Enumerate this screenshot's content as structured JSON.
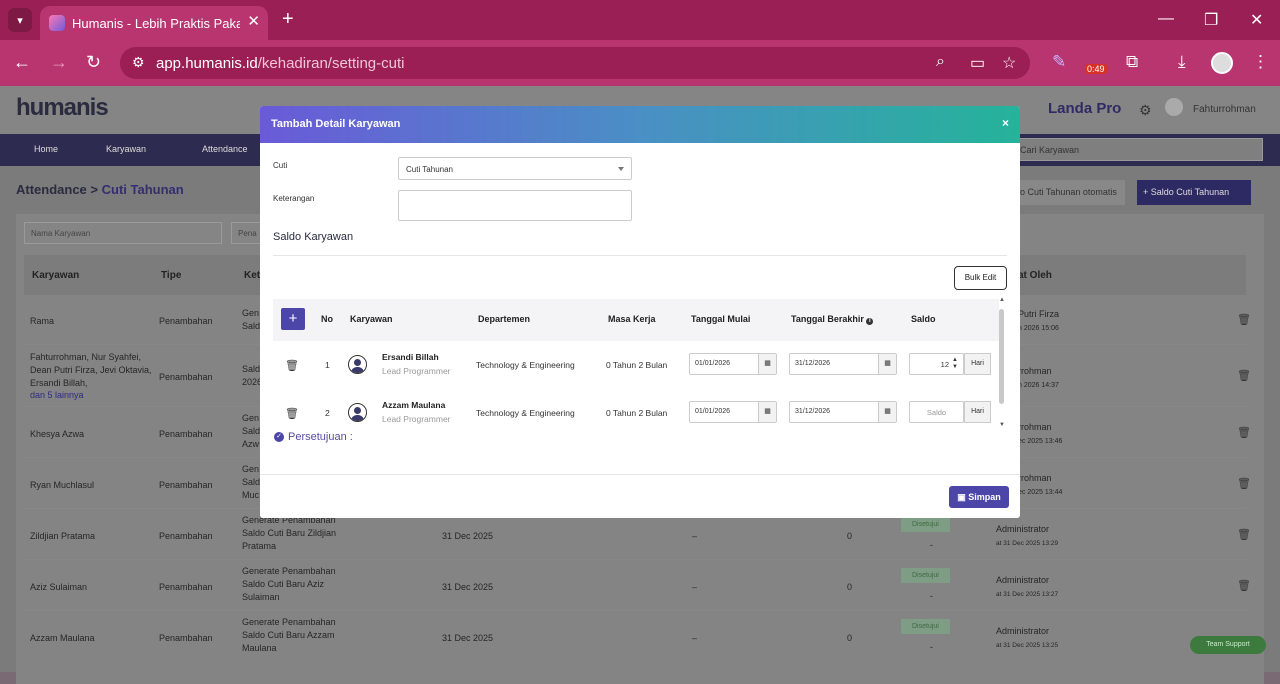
{
  "browser": {
    "tab_title": "Humanis - Lebih Praktis Pakai H",
    "url_host": "app.humanis.id",
    "url_path": "/kehadiran/setting-cuti",
    "timer_badge": "0:49",
    "new_tab": "+",
    "close": "✕",
    "min": "—",
    "restore": "❐",
    "win_close": "✕"
  },
  "app": {
    "logo": "humanis",
    "plan": "Landa Pro",
    "user": "Fahturrohman",
    "nav": [
      "Home",
      "Karyawan",
      "Attendance"
    ],
    "nav_search_placeholder": "Cari Karyawan",
    "breadcrumb_root": "Attendance",
    "breadcrumb_current": "Cuti Tahunan",
    "btn_auto": "o Cuti Tahunan otomatis",
    "btn_add": "Saldo Cuti Tahunan",
    "filter_name": "Nama Karyawan",
    "filter_type": "Pena",
    "columns": [
      "Karyawan",
      "Tipe",
      "Ket",
      "at Oleh"
    ],
    "rows": [
      {
        "karyawan": "Rama",
        "tipe": "Penambahan",
        "ket": "Gen\nSald",
        "by": "Putri Firza",
        "at": "n 2026 15:06"
      },
      {
        "karyawan": "Fahturrohman, Nur Syahfei, Dean Putri Firza, Jevi Oktavia, Ersandi Billah,",
        "more": "dan 5 lainnya",
        "tipe": "Penambahan",
        "ket": "Sald\n2026",
        "by": "rrohman",
        "at": "n 2026 14:37"
      },
      {
        "karyawan": "Khesya Azwa",
        "tipe": "Penambahan",
        "ket": "Gen\nSald\nAzw",
        "by": "rrohman",
        "at": "ec 2025 13:46"
      },
      {
        "karyawan": "Ryan Muchlasul",
        "tipe": "Penambahan",
        "ket": "Gen\nSald\nMuc",
        "by": "rrohman",
        "at": "ec 2025 13:44"
      },
      {
        "karyawan": "Zildjian Pratama",
        "tipe": "Penambahan",
        "ket": "Generate Penambahan Saldo Cuti Baru Zildjian Pratama",
        "date": "31 Dec 2025",
        "dash": "–",
        "zero": "0",
        "status": "Disetujui",
        "sub": "-",
        "by": "Administrator",
        "at": "at 31 Dec 2025 13:29"
      },
      {
        "karyawan": "Aziz Sulaiman",
        "tipe": "Penambahan",
        "ket": "Generate Penambahan Saldo Cuti Baru Aziz Sulaiman",
        "date": "31 Dec 2025",
        "dash": "–",
        "zero": "0",
        "status": "Disetujui",
        "sub": "-",
        "by": "Administrator",
        "at": "at 31 Dec 2025 13:27"
      },
      {
        "karyawan": "Azzam Maulana",
        "tipe": "Penambahan",
        "ket": "Generate Penambahan Saldo Cuti Baru Azzam Maulana",
        "date": "31 Dec 2025",
        "dash": "–",
        "zero": "0",
        "status": "Disetujui",
        "sub": "-",
        "by": "Administrator",
        "at": "at 31 Dec 2025 13:25"
      }
    ],
    "support": "Team Support"
  },
  "modal": {
    "title": "Tambah Detail Karyawan",
    "close": "×",
    "cuti_label": "Cuti",
    "cuti_value": "Cuti Tahunan",
    "keterangan_label": "Keterangan",
    "section_title": "Saldo Karyawan",
    "bulk_edit": "Bulk Edit",
    "add": "+",
    "columns": [
      "No",
      "Karyawan",
      "Departemen",
      "Masa Kerja",
      "Tanggal Mulai",
      "Tanggal Berakhir",
      "Saldo"
    ],
    "rows": [
      {
        "no": "1",
        "name": "Ersandi Billah",
        "role": "Lead Programmer",
        "dept": "Technology & Engineering",
        "masa": "0 Tahun 2 Bulan",
        "mulai": "01/01/2026",
        "akhir": "31/12/2026",
        "saldo": "12",
        "saldo_placeholder": "",
        "unit": "Hari"
      },
      {
        "no": "2",
        "name": "Azzam Maulana",
        "role": "Lead Programmer",
        "dept": "Technology & Engineering",
        "masa": "0 Tahun 2 Bulan",
        "mulai": "01/01/2026",
        "akhir": "31/12/2026",
        "saldo": "",
        "saldo_placeholder": "Saldo",
        "unit": "Hari"
      }
    ],
    "persetujuan": "Persetujuan :",
    "simpan": "Simpan"
  }
}
